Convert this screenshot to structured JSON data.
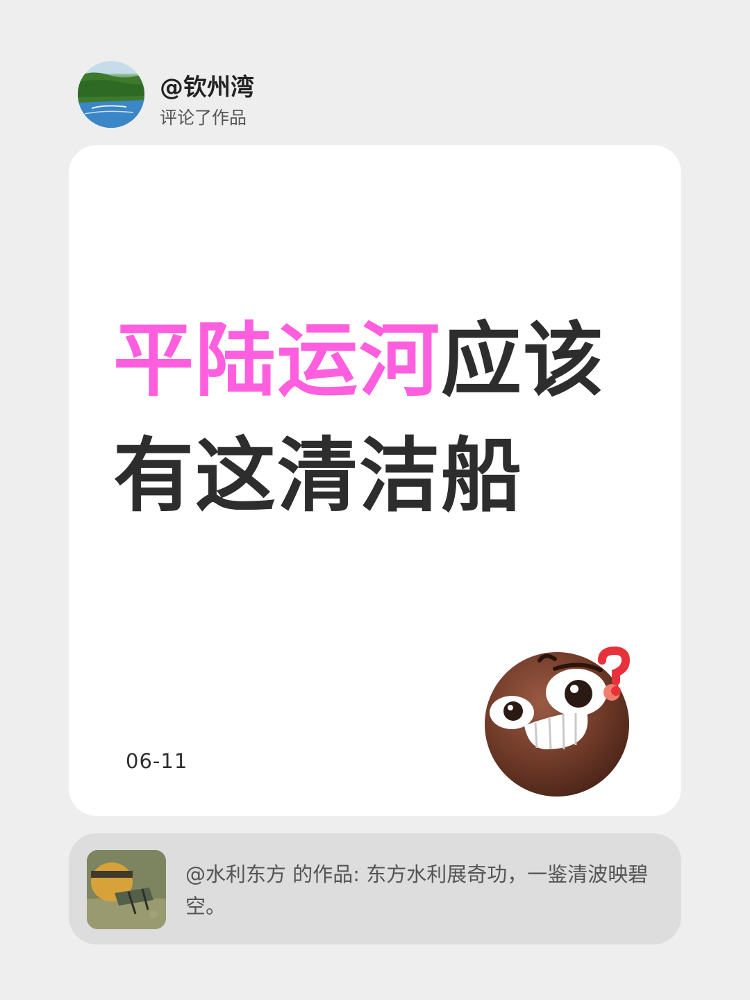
{
  "user": {
    "name": "@钦州湾",
    "action": "评论了作品"
  },
  "comment": {
    "headline_accent": "平陆运河",
    "headline_rest": "应该有这清洁船",
    "date": "06-11",
    "sticker": "confused-grinning-face-emoji"
  },
  "quoted_work": {
    "text": "@水利东方 的作品: 东方水利展奇功，一鉴清波映碧空。",
    "thumb": "river-cleaning-machine-photo"
  },
  "colors": {
    "background": "#eeeeee",
    "accent": "#ff5fde",
    "headline": "#2d2d2d"
  }
}
